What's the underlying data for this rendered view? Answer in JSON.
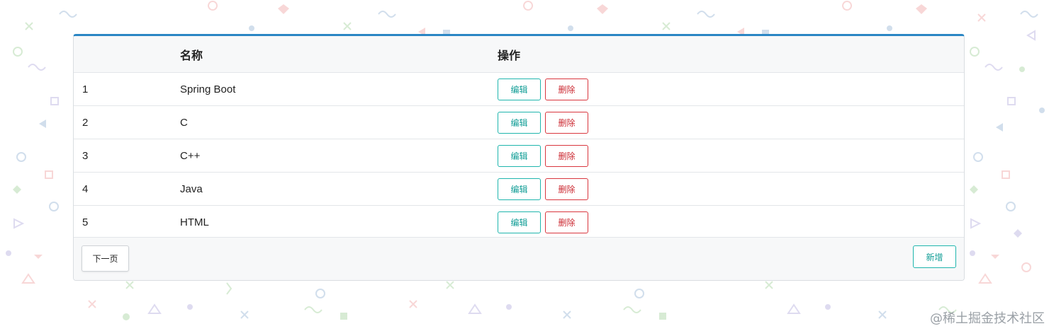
{
  "table": {
    "headers": {
      "index": "",
      "name": "名称",
      "actions": "操作"
    },
    "rows": [
      {
        "id": "1",
        "name": "Spring Boot",
        "edit_label": "编辑",
        "delete_label": "删除"
      },
      {
        "id": "2",
        "name": "C",
        "edit_label": "编辑",
        "delete_label": "删除"
      },
      {
        "id": "3",
        "name": "C++",
        "edit_label": "编辑",
        "delete_label": "删除"
      },
      {
        "id": "4",
        "name": "Java",
        "edit_label": "编辑",
        "delete_label": "删除"
      },
      {
        "id": "5",
        "name": "HTML",
        "edit_label": "编辑",
        "delete_label": "删除"
      }
    ]
  },
  "footer": {
    "next_label": "下一页",
    "add_label": "新增"
  },
  "watermark": "@稀土掘金技术社区",
  "colors": {
    "accent_top_border": "#2a86c4",
    "edit_button": "#1fb5ad",
    "delete_button": "#d9363e",
    "header_background": "#f7f8f9"
  }
}
